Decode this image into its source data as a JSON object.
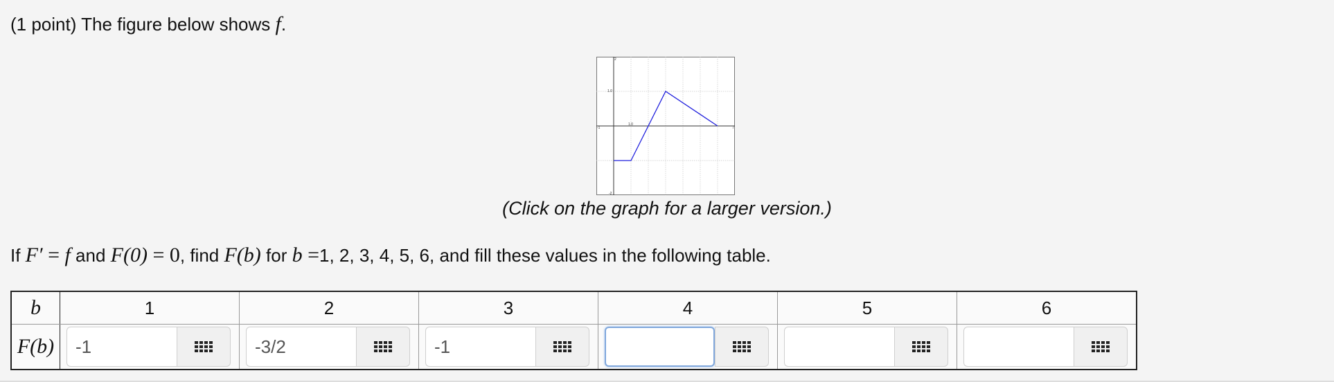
{
  "header": {
    "prefix": "(1 point) The figure below shows ",
    "func": "f",
    "suffix": "."
  },
  "graph": {
    "y_max_label": "2",
    "y_one_label": "1.0",
    "x_one_label": "1.0",
    "x_min_label": "-1",
    "x_max_label": "7",
    "y_min_label": "-2",
    "line_color": "#2222dd"
  },
  "chart_data": {
    "type": "line",
    "x": [
      0,
      1,
      3,
      6
    ],
    "y": [
      -1,
      -1,
      1,
      0
    ],
    "xlim": [
      -1,
      7
    ],
    "ylim": [
      -2,
      2
    ]
  },
  "caption": "(Click on the graph for a larger version.)",
  "question": {
    "if": "If ",
    "F_prime": "F′",
    "eq1": " = ",
    "f": "f",
    "and": " and ",
    "F0": "F(0)",
    "eq2": " = ",
    "zero": "0",
    "find": ", find ",
    "Fb": "F(b)",
    "for": " for ",
    "b": "b",
    "eq3": " =",
    "rest": "1, 2, 3, 4, 5, 6, and fill these values in the following table."
  },
  "table": {
    "row1_label": "b",
    "row2_label": "F(b)",
    "columns": [
      {
        "b": "1",
        "value": "-1"
      },
      {
        "b": "2",
        "value": "-3/2"
      },
      {
        "b": "3",
        "value": "-1"
      },
      {
        "b": "4",
        "value": ""
      },
      {
        "b": "5",
        "value": ""
      },
      {
        "b": "6",
        "value": ""
      }
    ],
    "palette_icon": "grid-palette-icon"
  }
}
